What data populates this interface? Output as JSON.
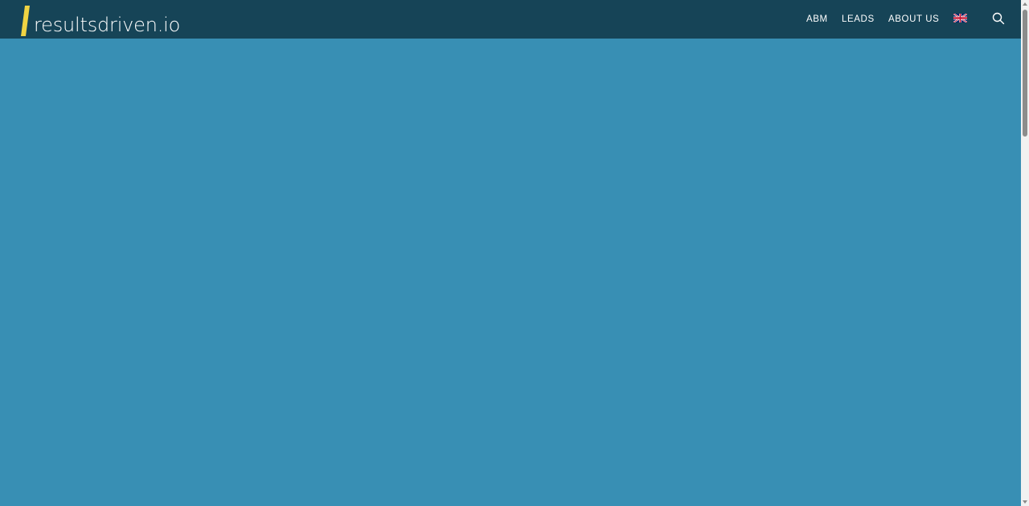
{
  "header": {
    "logo_text": "resultsdriven.io",
    "nav": [
      {
        "label": "ABM"
      },
      {
        "label": "LEADS"
      },
      {
        "label": "ABOUT US"
      }
    ],
    "language_icon": "uk-flag-icon",
    "search_icon": "search-icon"
  },
  "colors": {
    "header_bg": "#164457",
    "page_bg": "#388fb4",
    "logo_accent": "#f0d443",
    "text": "#ffffff"
  }
}
